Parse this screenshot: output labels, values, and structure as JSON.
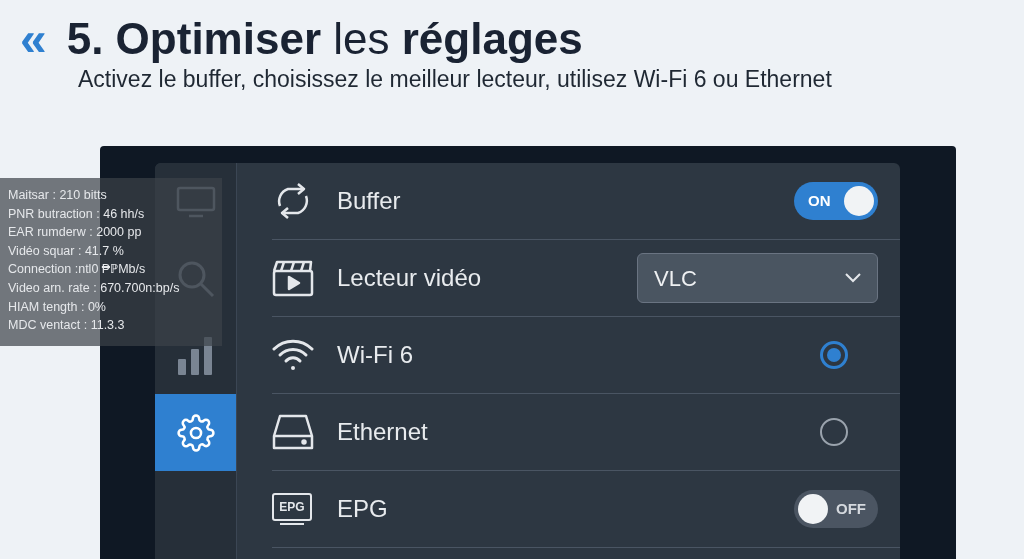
{
  "header": {
    "back_glyph": "«",
    "title": "**5. Optimiser** les **réglages**",
    "subtitle": "Activez le buffer, choisissez le meilleur lecteur, utilisez Wi-Fi 6 ou Ethernet"
  },
  "stats_overlay": [
    "Maitsar : 210 bitts",
    "PNR butraction : 46 hh/s",
    "EAR rumderw : 2000 pp",
    "Vidéo squar : 41.7 %",
    "Connection :ntl0 ₱ℙMb/s",
    "Video arn. rate : 670.700n:bp/s",
    "HIAM tength : 0%",
    "MDC ventact : 11.3.3"
  ],
  "sidebar": [
    {
      "kind": "tv",
      "selected": false
    },
    {
      "kind": "search",
      "selected": false
    },
    {
      "kind": "signal",
      "selected": false
    },
    {
      "kind": "settings",
      "selected": true
    }
  ],
  "settings": [
    {
      "kind": "toggle",
      "label": "Buffer",
      "on": true,
      "state_label": "ON"
    },
    {
      "kind": "dropdown",
      "label": "Lecteur vidéo",
      "value": "VLC"
    },
    {
      "kind": "radio",
      "label": "Wi-Fi 6",
      "selected": true
    },
    {
      "kind": "radio",
      "label": "Ethernet",
      "selected": false
    },
    {
      "kind": "toggle",
      "label": "EPG",
      "icon_text": "EPG",
      "on": false,
      "state_label": "OFF"
    }
  ]
}
